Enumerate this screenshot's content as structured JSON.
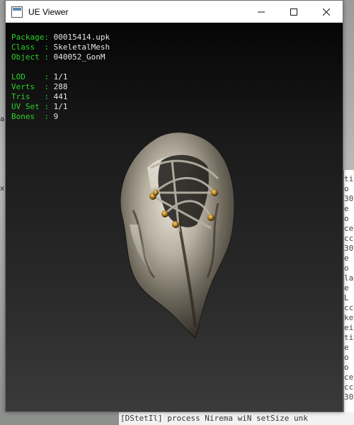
{
  "window": {
    "title": "UE Viewer"
  },
  "info_panel": {
    "sections": [
      [
        {
          "key": "Package: ",
          "value": "00015414.upk"
        },
        {
          "key": "Class  : ",
          "value": "SkeletalMesh"
        },
        {
          "key": "Object : ",
          "value": "040052_GonM"
        }
      ],
      [
        {
          "key": "LOD    : ",
          "value": "1/1"
        },
        {
          "key": "Verts  : ",
          "value": "288"
        },
        {
          "key": "Tris   : ",
          "value": "441"
        },
        {
          "key": "UV Set : ",
          "value": "1/1"
        },
        {
          "key": "Bones  : ",
          "value": "9"
        }
      ]
    ]
  },
  "background_console": {
    "bottom_line": "[DStetIl] process  Nirema wiN setSize  unk",
    "side_chars": [
      "ti",
      "o",
      "30",
      "e",
      "o",
      "ce",
      "cc",
      "30",
      "e",
      "o",
      "la",
      "e",
      "L",
      "cc",
      "ke",
      "ei",
      "ti",
      "e",
      "o",
      "o",
      "ce",
      "cc",
      "30"
    ]
  },
  "colors": {
    "label_green": "#29d229",
    "value_text": "#e6e6e6",
    "viewport_top": "#050505",
    "viewport_bottom": "#3a3a3a"
  }
}
